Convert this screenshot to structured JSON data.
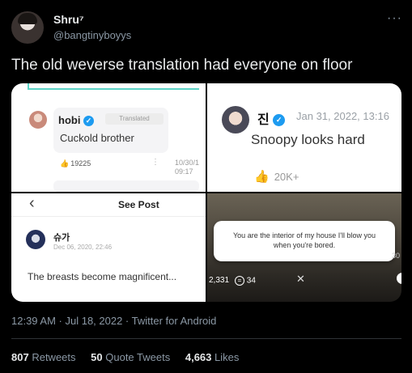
{
  "author": {
    "name": "Shru",
    "name_suffix": "⁷",
    "handle": "@bangtinyboyys"
  },
  "more_glyph": "···",
  "tweet": {
    "text": "The old weverse translation had everyone on floor",
    "timestamp": "12:39 AM · Jul 18, 2022 · Twitter for Android"
  },
  "panels": {
    "hobi": {
      "name": "hobi",
      "translated_badge": "Translated",
      "message": "Cuckold brother",
      "like_count": "19225",
      "date_line1": "10/30/1",
      "date_line2": "09:17",
      "dots": "⋮"
    },
    "jin": {
      "name": "진",
      "date": "Jan 31, 2022, 13:16",
      "message": "Snoopy looks hard",
      "likes": "20K+"
    },
    "suga": {
      "header_title": "See Post",
      "back_glyph": "‹",
      "name": "슈가",
      "date": "Dec 06, 2020, 22:46",
      "message": "The breasts become magnificent..."
    },
    "dialog": {
      "text_line1": "You are the interior of my house I'll blow you",
      "text_line2": "when you're bored.",
      "likes": "2,331",
      "comments": "34",
      "close_glyph": "✕",
      "side_text": "30"
    }
  },
  "engagement": {
    "retweets_count": "807",
    "retweets_label": "Retweets",
    "quotes_count": "50",
    "quotes_label": "Quote Tweets",
    "likes_count": "4,663",
    "likes_label": "Likes"
  },
  "colors": {
    "background": "#000000",
    "verified": "#1d9bf0",
    "teal_accent": "#5cd3c6",
    "muted": "#8b98a5"
  },
  "icons": [
    "verified-badge-icon",
    "thumbs-up-icon",
    "comment-icon",
    "close-icon",
    "back-arrow-icon",
    "more-icon"
  ]
}
